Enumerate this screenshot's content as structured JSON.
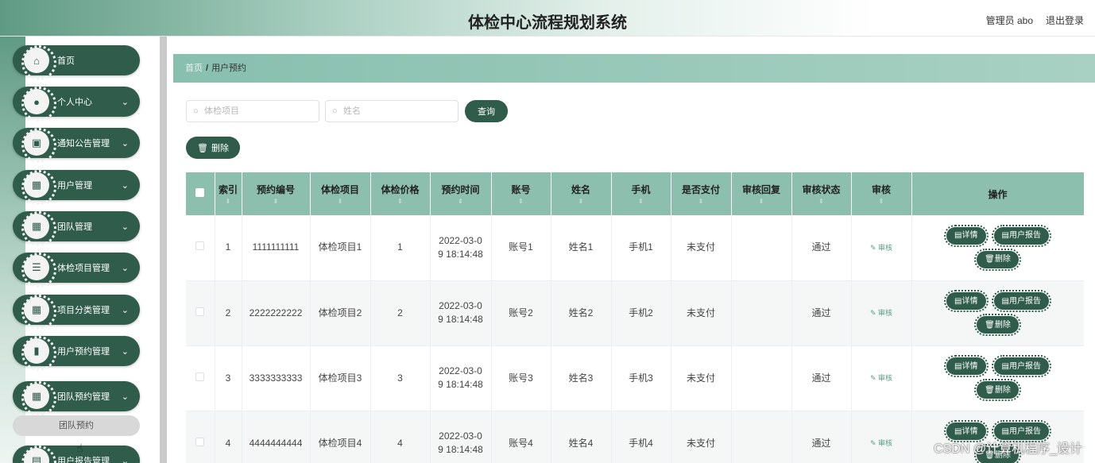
{
  "header": {
    "title": "体检中心流程规划系统",
    "admin": "管理员 abo",
    "logout": "退出登录"
  },
  "sidebar": {
    "items": [
      {
        "label": "首页",
        "icon": "home-icon",
        "glyph": "⌂",
        "chevron": false
      },
      {
        "label": "个人中心",
        "icon": "user-icon",
        "glyph": "●",
        "chevron": true
      },
      {
        "label": "通知公告管理",
        "icon": "clipboard-icon",
        "glyph": "▣",
        "chevron": true
      },
      {
        "label": "用户管理",
        "icon": "grid-icon",
        "glyph": "▦",
        "chevron": true
      },
      {
        "label": "团队管理",
        "icon": "grid-icon",
        "glyph": "▦",
        "chevron": true
      },
      {
        "label": "体检项目管理",
        "icon": "sliders-icon",
        "glyph": "☰",
        "chevron": true
      },
      {
        "label": "项目分类管理",
        "icon": "grid-icon",
        "glyph": "▦",
        "chevron": true
      },
      {
        "label": "用户预约管理",
        "icon": "bar-chart-icon",
        "glyph": "▮",
        "chevron": true
      },
      {
        "label": "团队预约管理",
        "icon": "grid-icon",
        "glyph": "▦",
        "chevron": true
      },
      {
        "label": "用户报告管理",
        "icon": "doc-icon",
        "glyph": "▤",
        "chevron": true
      }
    ],
    "sub_item": "团队预约"
  },
  "breadcrumb": {
    "home": "首页",
    "separator": "/",
    "current": "用户预约"
  },
  "search": {
    "item_placeholder": "体检项目",
    "name_placeholder": "姓名",
    "query_label": "查询"
  },
  "toolbar": {
    "delete_label": "删除"
  },
  "table": {
    "headers": [
      "索引",
      "预约编号",
      "体检项目",
      "体检价格",
      "预约时间",
      "账号",
      "姓名",
      "手机",
      "是否支付",
      "审核回复",
      "审核状态",
      "审核",
      "操作"
    ],
    "rows": [
      {
        "index": "1",
        "code": "1111111111",
        "item": "体检项目1",
        "price": "1",
        "time": "2022-03-09 18:14:48",
        "account": "账号1",
        "name": "姓名1",
        "phone": "手机1",
        "paid": "未支付",
        "reply": "",
        "status": "通过"
      },
      {
        "index": "2",
        "code": "2222222222",
        "item": "体检项目2",
        "price": "2",
        "time": "2022-03-09 18:14:48",
        "account": "账号2",
        "name": "姓名2",
        "phone": "手机2",
        "paid": "未支付",
        "reply": "",
        "status": "通过"
      },
      {
        "index": "3",
        "code": "3333333333",
        "item": "体检项目3",
        "price": "3",
        "time": "2022-03-09 18:14:48",
        "account": "账号3",
        "name": "姓名3",
        "phone": "手机3",
        "paid": "未支付",
        "reply": "",
        "status": "通过"
      },
      {
        "index": "4",
        "code": "4444444444",
        "item": "体检项目4",
        "price": "4",
        "time": "2022-03-09 18:14:48",
        "account": "账号4",
        "name": "姓名4",
        "phone": "手机4",
        "paid": "未支付",
        "reply": "",
        "status": "通过"
      }
    ],
    "audit_link": "审核",
    "op_detail": "详情",
    "op_report": "用户报告",
    "op_delete": "删除"
  },
  "watermark": "CSDN @计算机程序_设计",
  "colors": {
    "primary": "#2f5c4b",
    "header_bg": "#8cbfae",
    "accent": "#5a9e85"
  }
}
